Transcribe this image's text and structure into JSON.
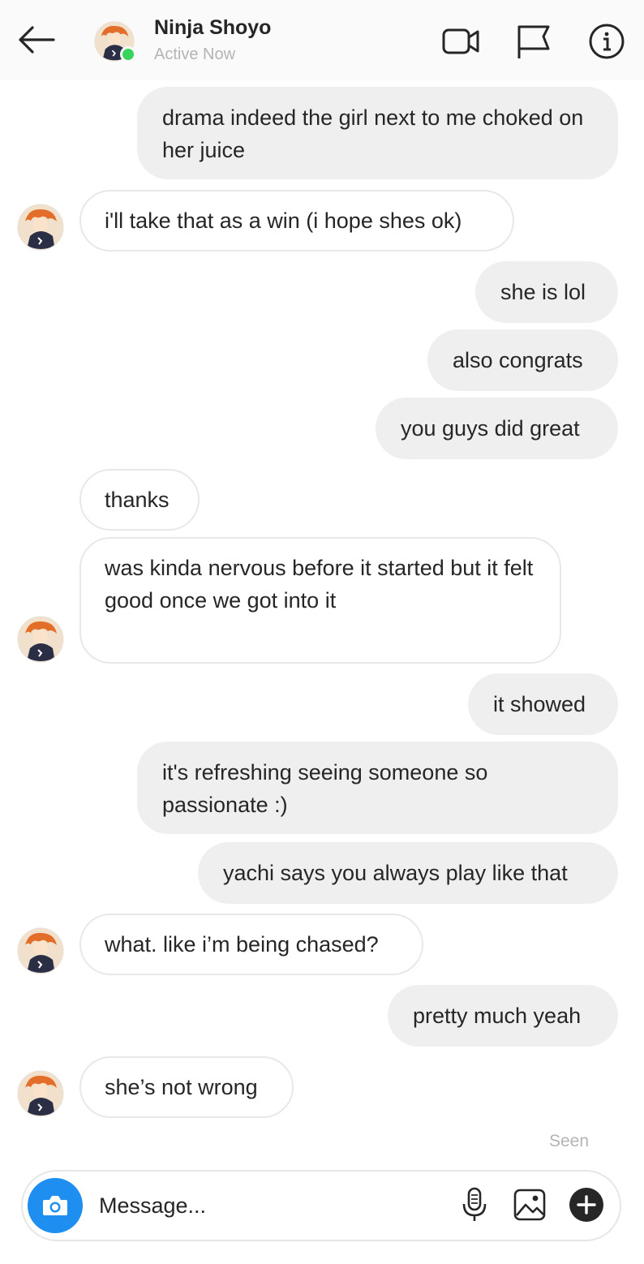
{
  "header": {
    "contact_name": "Ninja Shoyo",
    "status": "Active Now",
    "icons": [
      "back-arrow-icon",
      "video-call-icon",
      "flag-icon",
      "info-icon"
    ]
  },
  "messages": [
    {
      "side": "sent",
      "text": "drama indeed the girl next to me choked on her juice"
    },
    {
      "side": "received",
      "text": "i'll take that as a win (i hope shes ok)"
    },
    {
      "side": "sent",
      "text": "she is lol"
    },
    {
      "side": "sent",
      "text": "also congrats"
    },
    {
      "side": "sent",
      "text": "you guys did great"
    },
    {
      "side": "received",
      "text": "thanks"
    },
    {
      "side": "received",
      "text": "was kinda nervous before it started but it felt good once we got into it"
    },
    {
      "side": "sent",
      "text": "it showed"
    },
    {
      "side": "sent",
      "text": "it's refreshing seeing someone so passionate :)"
    },
    {
      "side": "sent",
      "text": "yachi says you always play like that"
    },
    {
      "side": "received",
      "text": "what. like i’m being chased?"
    },
    {
      "side": "sent",
      "text": "pretty much yeah"
    },
    {
      "side": "received",
      "text": "she’s not wrong"
    }
  ],
  "seen_label": "Seen",
  "composer": {
    "placeholder": "Message...",
    "icons": [
      "camera-icon",
      "microphone-icon",
      "image-icon",
      "plus-icon"
    ]
  },
  "colors": {
    "sent_bubble": "#efefef",
    "received_bubble_border": "#e8e8e8",
    "online_dot": "#3ad35b",
    "camera_button": "#1e8ff0",
    "muted_text": "#b4b4b4"
  }
}
